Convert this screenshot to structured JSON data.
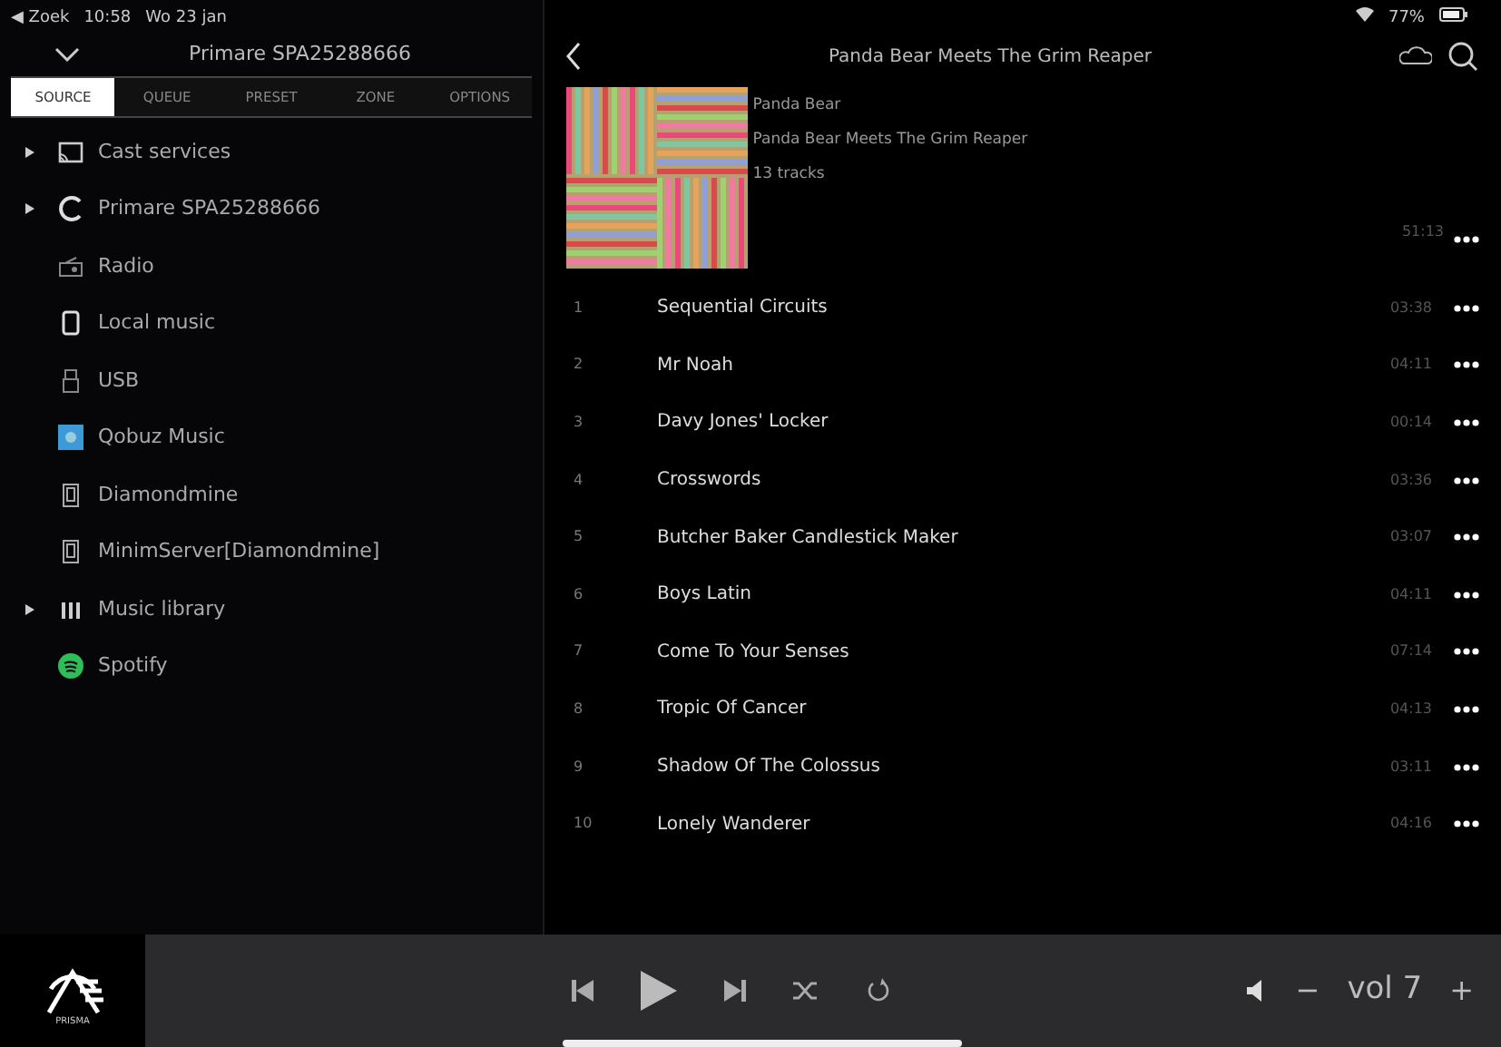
{
  "status_bar": {
    "back": "◀ Zoek",
    "time": "10:58",
    "date": "Wo 23 jan",
    "battery": "77%"
  },
  "sidebar": {
    "title": "Primare SPA25288666",
    "tabs": [
      {
        "label": "SOURCE",
        "selected": true
      },
      {
        "label": "QUEUE",
        "selected": false
      },
      {
        "label": "PRESET",
        "selected": false
      },
      {
        "label": "ZONE",
        "selected": false
      },
      {
        "label": "OPTIONS",
        "selected": false
      }
    ],
    "items": [
      {
        "label": "Cast services",
        "kind": "cast",
        "expandable": true
      },
      {
        "label": "Primare SPA25288666",
        "kind": "device",
        "expandable": true
      },
      {
        "label": "Radio",
        "kind": "radio",
        "expandable": false
      },
      {
        "label": "Local music",
        "kind": "phone",
        "expandable": false
      },
      {
        "label": "USB",
        "kind": "usb",
        "expandable": false
      },
      {
        "label": "Qobuz Music",
        "kind": "qobuz",
        "expandable": false
      },
      {
        "label": "Diamondmine",
        "kind": "server",
        "expandable": false
      },
      {
        "label": "MinimServer[Diamondmine]",
        "kind": "server",
        "expandable": false
      },
      {
        "label": "Music library",
        "kind": "library",
        "expandable": true
      },
      {
        "label": "Spotify",
        "kind": "spotify",
        "expandable": false
      }
    ]
  },
  "album": {
    "title": "Panda Bear Meets The Grim Reaper",
    "artist": "Panda Bear",
    "album": "Panda Bear Meets The Grim Reaper",
    "tracks_count": "13 tracks",
    "total": "51:13",
    "tracks": [
      {
        "number": "1",
        "title": "Sequential Circuits",
        "duration": "03:38"
      },
      {
        "number": "2",
        "title": "Mr Noah",
        "duration": "04:11"
      },
      {
        "number": "3",
        "title": "Davy Jones' Locker",
        "duration": "00:14"
      },
      {
        "number": "4",
        "title": "Crosswords",
        "duration": "03:36"
      },
      {
        "number": "5",
        "title": "Butcher Baker Candlestick Maker",
        "duration": "03:07"
      },
      {
        "number": "6",
        "title": "Boys Latin",
        "duration": "04:11"
      },
      {
        "number": "7",
        "title": "Come To Your Senses",
        "duration": "07:14"
      },
      {
        "number": "8",
        "title": "Tropic Of Cancer",
        "duration": "04:13"
      },
      {
        "number": "9",
        "title": "Shadow Of The Colossus",
        "duration": "03:11"
      },
      {
        "number": "10",
        "title": "Lonely Wanderer",
        "duration": "04:16"
      }
    ]
  },
  "player": {
    "logo": "PRISMA",
    "volume": "vol 7",
    "minus": "−",
    "plus": "+"
  }
}
